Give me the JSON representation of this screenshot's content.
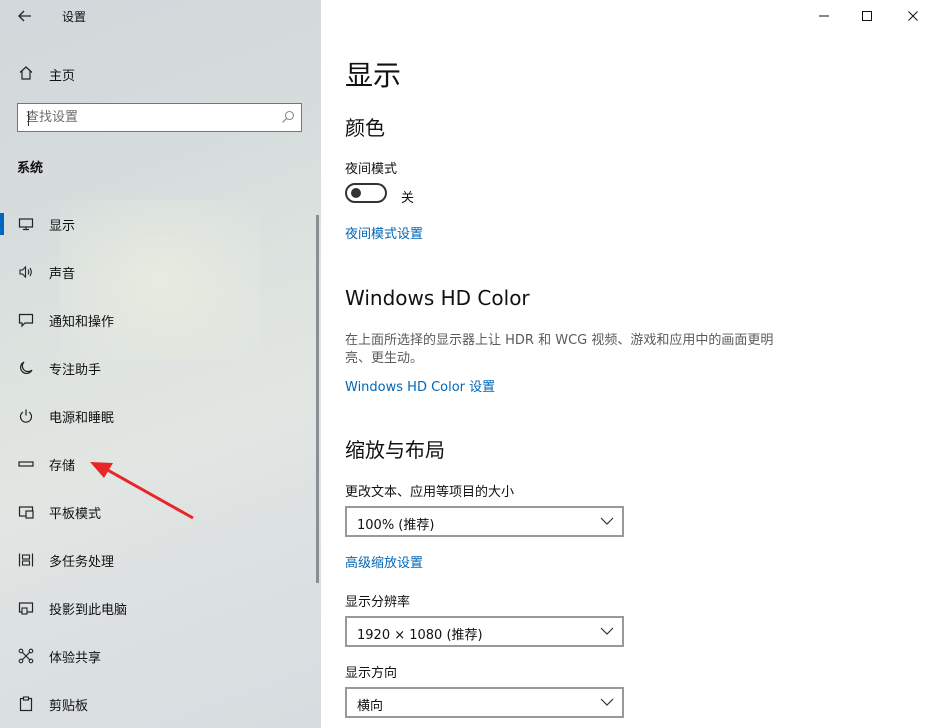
{
  "window": {
    "title": "设置"
  },
  "sidebar": {
    "home_label": "主页",
    "search_placeholder": "查找设置",
    "section_title": "系统",
    "items": [
      {
        "label": "显示",
        "icon": "monitor-icon",
        "active": true
      },
      {
        "label": "声音",
        "icon": "speaker-icon",
        "active": false
      },
      {
        "label": "通知和操作",
        "icon": "message-icon",
        "active": false
      },
      {
        "label": "专注助手",
        "icon": "moon-icon",
        "active": false
      },
      {
        "label": "电源和睡眠",
        "icon": "power-icon",
        "active": false
      },
      {
        "label": "存储",
        "icon": "storage-drive-icon",
        "active": false
      },
      {
        "label": "平板模式",
        "icon": "tablet-icon",
        "active": false
      },
      {
        "label": "多任务处理",
        "icon": "multitask-icon",
        "active": false
      },
      {
        "label": "投影到此电脑",
        "icon": "project-icon",
        "active": false
      },
      {
        "label": "体验共享",
        "icon": "share-icon",
        "active": false
      },
      {
        "label": "剪贴板",
        "icon": "clipboard-icon",
        "active": false
      }
    ]
  },
  "main": {
    "page_title": "显示",
    "color_section": {
      "heading": "颜色",
      "night_mode_label": "夜间模式",
      "night_mode_state": "关",
      "night_mode_link": "夜间模式设置"
    },
    "hd_section": {
      "heading": "Windows HD Color",
      "description": "在上面所选择的显示器上让 HDR 和 WCG 视频、游戏和应用中的画面更明亮、更生动。",
      "link": "Windows HD Color 设置"
    },
    "scale_section": {
      "heading": "缩放与布局",
      "scale_label": "更改文本、应用等项目的大小",
      "scale_value": "100% (推荐)",
      "advanced_link": "高级缩放设置",
      "resolution_label": "显示分辨率",
      "resolution_value": "1920 × 1080 (推荐)",
      "orientation_label": "显示方向",
      "orientation_value": "横向"
    }
  },
  "colors": {
    "accent": "#0067c0",
    "link": "#0067b8",
    "annotation_arrow": "#e8262a"
  }
}
